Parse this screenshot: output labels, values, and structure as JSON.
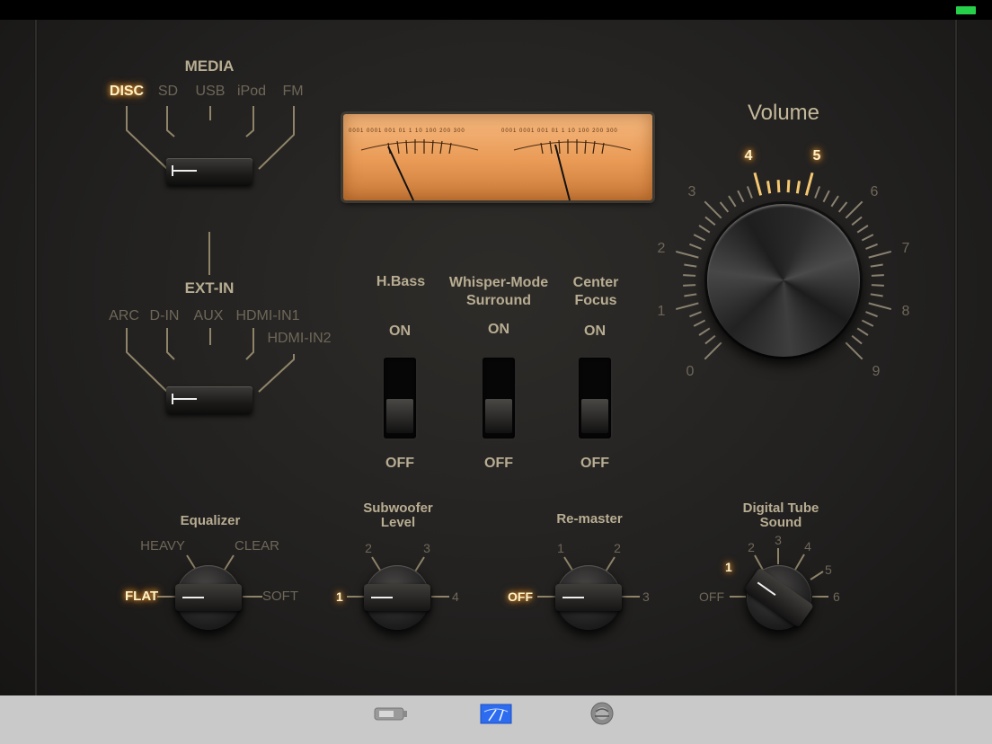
{
  "media": {
    "title": "MEDIA",
    "options": [
      "DISC",
      "SD",
      "USB",
      "iPod",
      "FM"
    ],
    "selected": "DISC"
  },
  "ext_in": {
    "title": "EXT-IN",
    "options": [
      "ARC",
      "D-IN",
      "AUX",
      "HDMI-IN1",
      "HDMI-IN2"
    ]
  },
  "vu_meter": {
    "scale": "0001 0001 001 01 1 10 100 200 300"
  },
  "switches": [
    {
      "label": "H.Bass",
      "on": "ON",
      "off": "OFF",
      "state": "OFF"
    },
    {
      "label": "Whisper-Mode Surround",
      "on": "ON",
      "off": "OFF",
      "state": "OFF"
    },
    {
      "label": "Center Focus",
      "on": "ON",
      "off": "OFF",
      "state": "OFF"
    }
  ],
  "volume": {
    "title": "Volume",
    "scale": [
      "0",
      "1",
      "2",
      "3",
      "4",
      "5",
      "6",
      "7",
      "8",
      "9"
    ],
    "highlighted": [
      "4",
      "5"
    ]
  },
  "equalizer": {
    "title": "Equalizer",
    "options": [
      "FLAT",
      "HEAVY",
      "CLEAR",
      "SOFT"
    ],
    "selected": "FLAT"
  },
  "subwoofer": {
    "title": "Subwoofer Level",
    "options": [
      "1",
      "2",
      "3",
      "4"
    ],
    "selected": "1"
  },
  "remaster": {
    "title": "Re-master",
    "options": [
      "OFF",
      "1",
      "2",
      "3"
    ],
    "selected": "OFF"
  },
  "digital_tube": {
    "title": "Digital Tube Sound",
    "options": [
      "OFF",
      "1",
      "2",
      "3",
      "4",
      "5",
      "6"
    ],
    "selected": "1"
  },
  "bottom_tabs": [
    {
      "icon": "device-icon",
      "active": false
    },
    {
      "icon": "meter-icon",
      "active": true
    },
    {
      "icon": "settings-disc-icon",
      "active": false
    }
  ],
  "colors": {
    "accent_glow": "#f7a83a",
    "battery": "#27d04a",
    "tab_active": "#2d6cf0"
  }
}
